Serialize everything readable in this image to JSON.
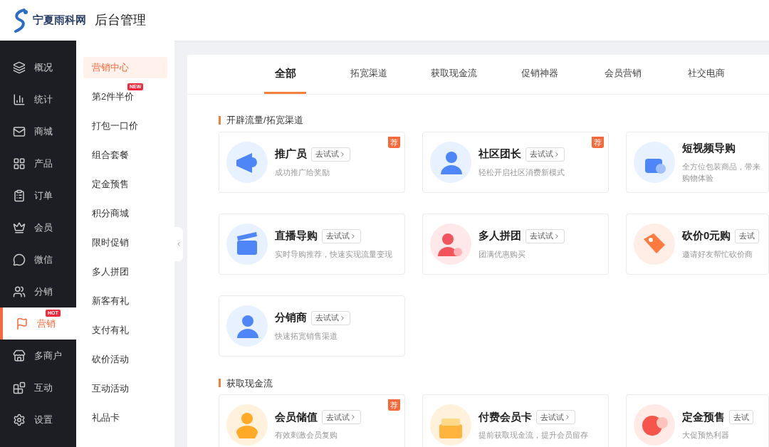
{
  "header": {
    "brand": "宁夏雨科网",
    "title": "后台管理"
  },
  "sidebar": {
    "items": [
      {
        "label": "概况",
        "selected": false
      },
      {
        "label": "统计",
        "selected": false
      },
      {
        "label": "商城",
        "selected": false
      },
      {
        "label": "产品",
        "selected": false
      },
      {
        "label": "订单",
        "selected": false
      },
      {
        "label": "会员",
        "selected": false
      },
      {
        "label": "微信",
        "selected": false
      },
      {
        "label": "分销",
        "selected": false
      },
      {
        "label": "营销",
        "selected": true,
        "badge": "HOT"
      },
      {
        "label": "多商户",
        "selected": false
      },
      {
        "label": "互动",
        "selected": false
      },
      {
        "label": "设置",
        "selected": false
      }
    ]
  },
  "submenu": {
    "items": [
      {
        "label": "营销中心",
        "selected": true
      },
      {
        "label": "第2件半价",
        "selected": false,
        "badge": "NEW"
      },
      {
        "label": "打包一口价",
        "selected": false
      },
      {
        "label": "组合套餐",
        "selected": false
      },
      {
        "label": "定金预售",
        "selected": false
      },
      {
        "label": "积分商城",
        "selected": false
      },
      {
        "label": "限时促销",
        "selected": false
      },
      {
        "label": "多人拼团",
        "selected": false
      },
      {
        "label": "新客有礼",
        "selected": false
      },
      {
        "label": "支付有礼",
        "selected": false
      },
      {
        "label": "砍价活动",
        "selected": false
      },
      {
        "label": "互动活动",
        "selected": false
      },
      {
        "label": "礼品卡",
        "selected": false
      }
    ]
  },
  "tabs": [
    {
      "label": "全部",
      "selected": true
    },
    {
      "label": "拓宽渠道",
      "selected": false
    },
    {
      "label": "获取现金流",
      "selected": false
    },
    {
      "label": "促销神器",
      "selected": false
    },
    {
      "label": "会员营销",
      "selected": false
    },
    {
      "label": "社交电商",
      "selected": false
    }
  ],
  "sections": [
    {
      "title": "开辟流量/拓宽渠道",
      "cards": [
        {
          "name": "推广员",
          "button": "去试试",
          "chevron": true,
          "desc": "成功推广给奖励",
          "badge": "荐"
        },
        {
          "name": "社区团长",
          "button": "去试试",
          "chevron": true,
          "desc": "轻松开启社区消费新模式",
          "badge": "荐"
        },
        {
          "name": "短视频导购",
          "desc": "全方位包装商品，带来购物体验"
        },
        {
          "name": "直播导购",
          "button": "去试试",
          "chevron": true,
          "desc": "实时导购推荐，快速实现流量变现"
        },
        {
          "name": "多人拼团",
          "button": "去试试",
          "chevron": true,
          "desc": "团满优惠购买"
        },
        {
          "name": "砍价0元购",
          "button": "去试",
          "chevron": false,
          "desc": "邀请好友帮忙砍价商"
        },
        {
          "name": "分销商",
          "button": "去试试",
          "chevron": true,
          "desc": "快速拓宽销售渠道"
        }
      ]
    },
    {
      "title": "获取现金流",
      "cards": [
        {
          "name": "会员储值",
          "button": "去试试",
          "chevron": true,
          "desc": "有效刺激会员复购",
          "badge": "荐"
        },
        {
          "name": "付费会员卡",
          "button": "去试试",
          "chevron": true,
          "desc": "提前获取现金流，提升会员留存"
        },
        {
          "name": "定金预售",
          "button": "去试",
          "chevron": false,
          "desc": "大促预热利器"
        }
      ]
    }
  ]
}
